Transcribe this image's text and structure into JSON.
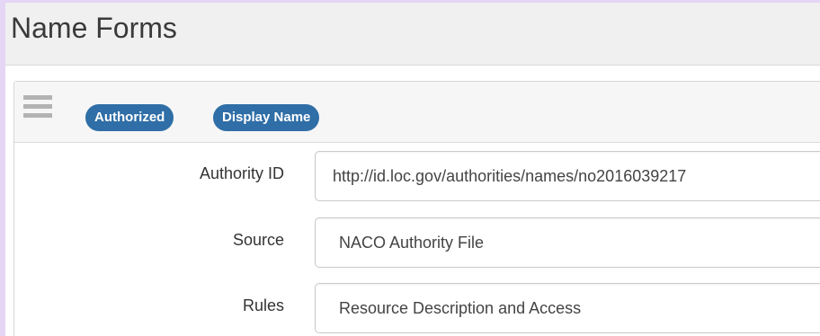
{
  "section": {
    "title": "Name Forms"
  },
  "panel": {
    "badges": [
      "Authorized",
      "Display Name"
    ],
    "rows": [
      {
        "label": "Authority ID",
        "value": "http://id.loc.gov/authorities/names/no2016039217"
      },
      {
        "label": "Source",
        "value": "NACO Authority File"
      },
      {
        "label": "Rules",
        "value": "Resource Description and Access"
      }
    ]
  },
  "colors": {
    "badge": "#2f6ea7",
    "page_background": "#e4d6f4",
    "header_background": "#f0f0f0"
  },
  "icons": {
    "drag_handle": "hamburger-drag-icon"
  }
}
